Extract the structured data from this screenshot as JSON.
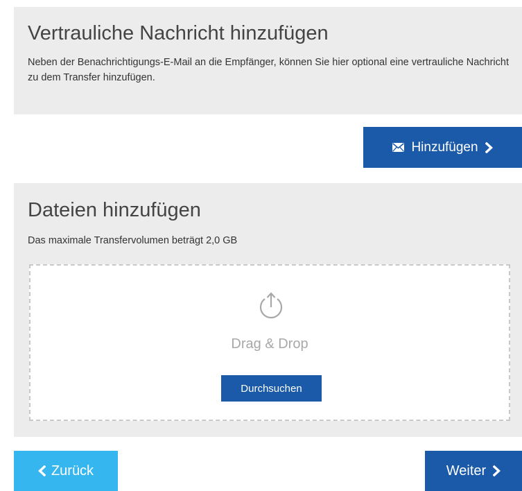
{
  "message_section": {
    "title": "Vertrauliche Nachricht hinzufügen",
    "description": "Neben der Benachrichtigungs-E-Mail an die Empfänger, können Sie hier optional eine vertrauliche Nachricht zu dem Transfer hinzufügen.",
    "add_button_label": "Hinzufügen",
    "add_button_icon": "envelope-icon"
  },
  "files_section": {
    "title": "Dateien hinzufügen",
    "max_volume_text": "Das maximale Transfervolumen beträgt 2,0 GB",
    "dropzone": {
      "icon": "upload-icon",
      "label": "Drag & Drop",
      "browse_button_label": "Durchsuchen"
    }
  },
  "navigation": {
    "back_label": "Zurück",
    "next_label": "Weiter"
  },
  "colors": {
    "primary": "#1a5aa8",
    "back_button": "#35b6ee",
    "panel_background": "#ececec",
    "dropzone_border": "#c9c9c9"
  }
}
